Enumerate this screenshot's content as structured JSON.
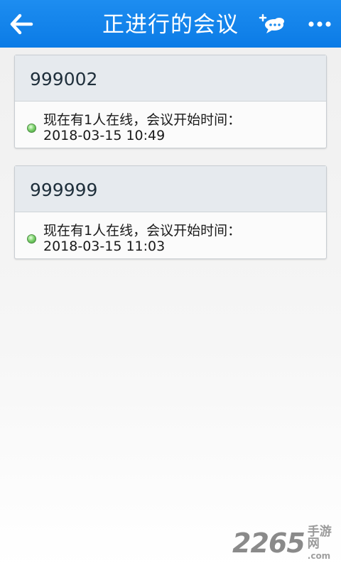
{
  "header": {
    "title": "正进行的会议",
    "back_icon": "arrow-left-icon",
    "new_meeting_icon": "new-meeting-icon",
    "more_icon": "more-dots-icon",
    "background_color": "#0b7be6"
  },
  "meetings": [
    {
      "id": "999002",
      "status_line": "现在有1人在线，会议开始时间：",
      "start_time": "2018-03-15 10:49",
      "status_color": "#5cc24e"
    },
    {
      "id": "999999",
      "status_line": "现在有1人在线，会议开始时间：",
      "start_time": "2018-03-15 11:03",
      "status_color": "#5cc24e"
    }
  ],
  "watermark": {
    "number": "2265",
    "text": "手游网",
    "domain": ".com"
  }
}
